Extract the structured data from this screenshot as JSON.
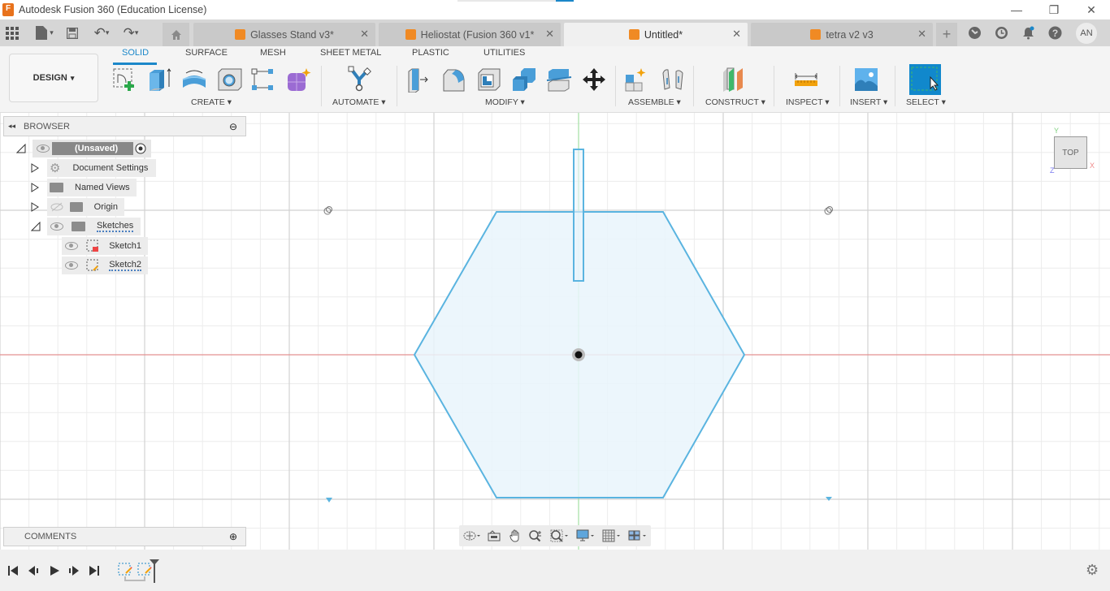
{
  "window": {
    "title": "Autodesk Fusion 360 (Education License)",
    "logo_letter": "F",
    "minimize": "—",
    "restore": "❐",
    "close": "✕"
  },
  "quick_access": {
    "grid_icon": "▦",
    "file_icon": "▤",
    "save_icon": "💾",
    "undo_icon": "↶",
    "redo_icon": "↷",
    "dropdown": "▾"
  },
  "tabs": [
    {
      "label": "Glasses Stand v3*",
      "active": false
    },
    {
      "label": "Heliostat (Fusion 360 v1*",
      "active": false
    },
    {
      "label": "Untitled*",
      "active": true
    },
    {
      "label": "tetra v2 v3",
      "active": false
    }
  ],
  "tab_close": "✕",
  "tab_add": "+",
  "header_icons": {
    "extensions": "◔",
    "job_status": "◷",
    "notifications": "🔔",
    "help": "?"
  },
  "user": {
    "initials": "AN"
  },
  "workspace": {
    "label": "DESIGN",
    "caret": "▾"
  },
  "ribbon_tabs": [
    "SOLID",
    "SURFACE",
    "MESH",
    "SHEET METAL",
    "PLASTIC",
    "UTILITIES"
  ],
  "ribbon_active_tab": "SOLID",
  "ribbon_groups": {
    "create": "CREATE ▾",
    "automate": "AUTOMATE ▾",
    "modify": "MODIFY ▾",
    "assemble": "ASSEMBLE ▾",
    "construct": "CONSTRUCT ▾",
    "inspect": "INSPECT ▾",
    "insert": "INSERT ▾",
    "select": "SELECT ▾"
  },
  "browser": {
    "title": "BROWSER",
    "collapse_icon": "◂◂",
    "minus_icon": "⊖",
    "root": "(Unsaved)",
    "items": [
      {
        "label": "Document Settings"
      },
      {
        "label": "Named Views"
      },
      {
        "label": "Origin"
      },
      {
        "label": "Sketches"
      }
    ],
    "sketches": [
      {
        "label": "Sketch1"
      },
      {
        "label": "Sketch2"
      }
    ]
  },
  "comments": {
    "title": "COMMENTS",
    "add_icon": "⊕"
  },
  "viewcube": {
    "face": "TOP",
    "x": "X",
    "y": "Y",
    "z": "Z"
  },
  "timeline": {
    "first": "⏮",
    "prev": "◀",
    "play": "▶",
    "next": "▶",
    "last": "⏭"
  },
  "settings_icon": "⚙",
  "colors": {
    "accent": "#1b87c9",
    "sketch_line": "#5ab4e0",
    "sketch_fill": "#e9f5fc",
    "x_axis": "#e86a6a",
    "y_axis": "#8fde8f",
    "tab_cube": "#f08a24"
  }
}
